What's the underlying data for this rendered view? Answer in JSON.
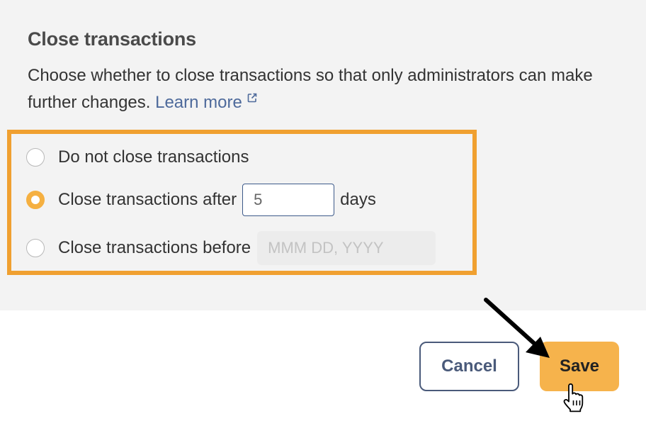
{
  "section": {
    "title": "Close transactions",
    "description": "Choose whether to close transactions so that only administrators can make further changes.",
    "learn_more": "Learn more"
  },
  "options": [
    {
      "label": "Do not close transactions",
      "selected": false
    },
    {
      "label": "Close transactions after",
      "selected": true,
      "input_value": "5",
      "suffix": "days"
    },
    {
      "label": "Close transactions before",
      "selected": false,
      "input_placeholder": "MMM DD, YYYY"
    }
  ],
  "buttons": {
    "cancel": "Cancel",
    "save": "Save"
  },
  "colors": {
    "highlight": "#f0a030",
    "accent": "#f5b041",
    "link": "#4e6a9b",
    "save_bg": "#f6b34c"
  }
}
